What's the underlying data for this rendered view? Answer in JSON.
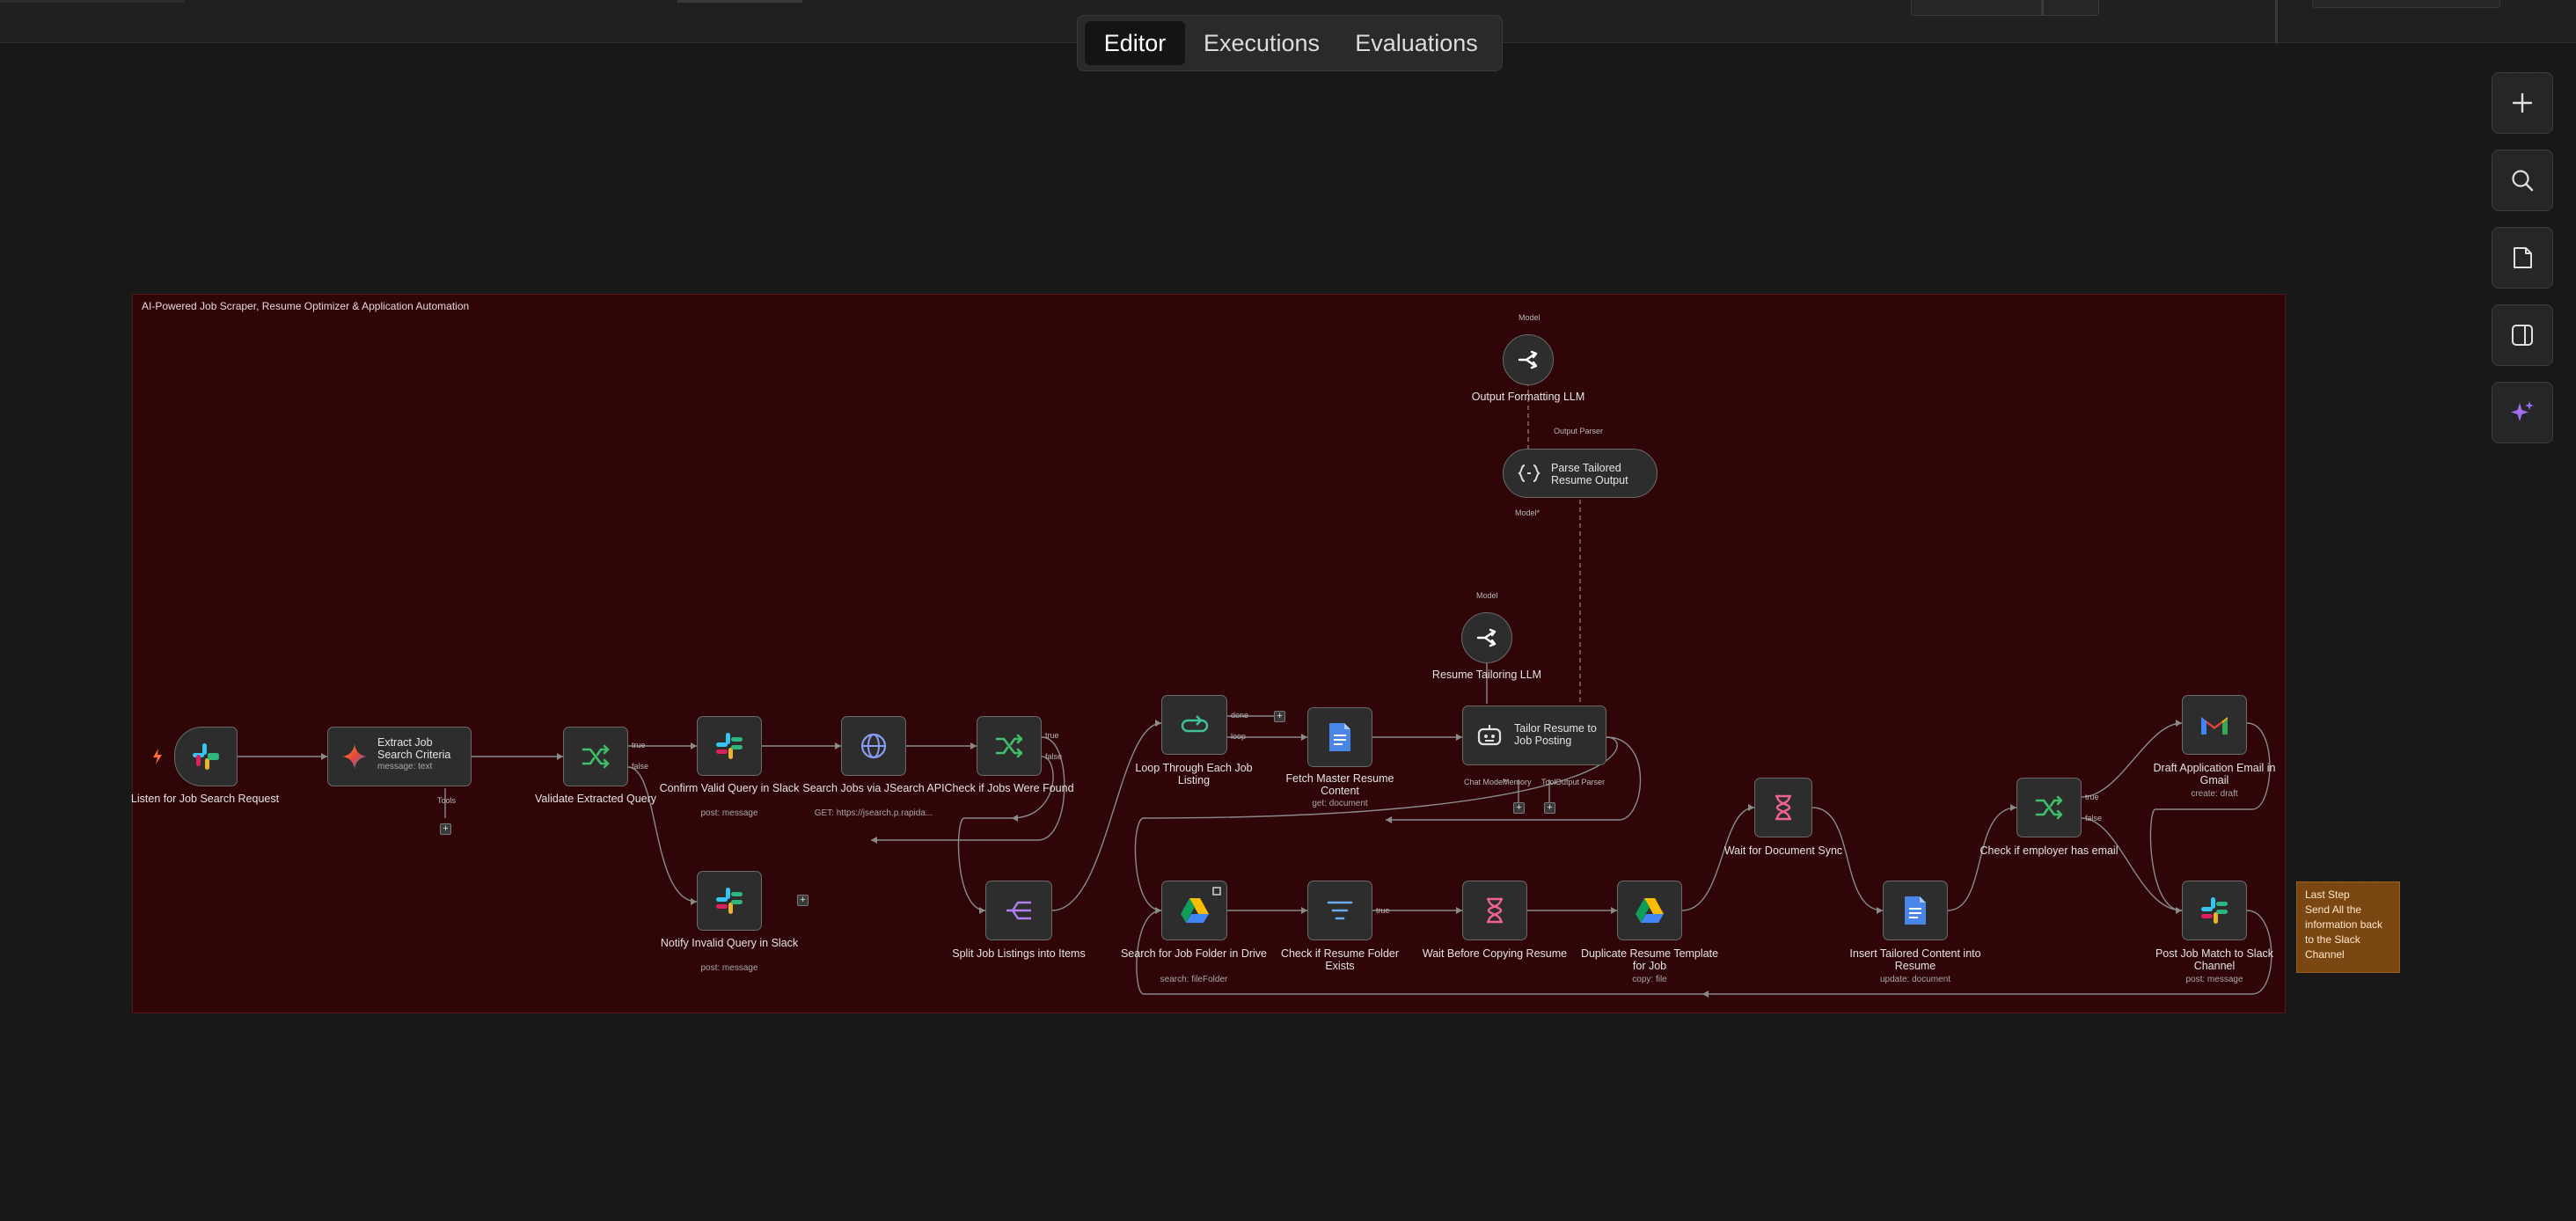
{
  "tabs": {
    "editor": "Editor",
    "executions": "Executions",
    "evaluations": "Evaluations"
  },
  "controls": [
    "plus-icon",
    "search-icon",
    "sticky-note-icon",
    "sidebar-icon",
    "sparkle-icon"
  ],
  "sticky_title": "AI-Powered Job Scraper, Resume Optimizer & Application Automation",
  "note": {
    "title": "Last Step",
    "body": [
      "Send All the",
      "information back",
      "to the Slack",
      "Channel"
    ]
  },
  "nodes": {
    "listen": {
      "label": "Listen for Job Search Request",
      "icon": "slack-icon"
    },
    "extract": {
      "label": "Extract Job Search Criteria",
      "sub": "message: text",
      "icon": "gemini-icon"
    },
    "validate": {
      "label": "Validate Extracted Query",
      "icon": "if-icon"
    },
    "confirm": {
      "label": "Confirm Valid Query in Slack",
      "sub": "post: message",
      "icon": "slack-icon"
    },
    "search": {
      "label": "Search Jobs via JSearch API",
      "sub": "GET: https://jsearch.p.rapida...",
      "icon": "globe-icon"
    },
    "check_found": {
      "label": "Check if Jobs Were Found",
      "icon": "if-icon"
    },
    "invalid": {
      "label": "Notify Invalid Query in Slack",
      "sub": "post: message",
      "icon": "slack-icon"
    },
    "split": {
      "label": "Split Job Listings into Items",
      "icon": "split-icon"
    },
    "loop": {
      "label": "Loop Through Each Job Listing",
      "icon": "loop-icon"
    },
    "fetch": {
      "label": "Fetch Master Resume Content",
      "sub": "get: document",
      "icon": "docs-icon"
    },
    "output_llm": {
      "label": "Output Formatting LLM",
      "icon": "openrouter-icon"
    },
    "parse": {
      "label": "Parse Tailored Resume Output",
      "icon": "braces-icon"
    },
    "tailor_llm": {
      "label": "Resume Tailoring LLM",
      "icon": "openrouter-icon"
    },
    "tailor": {
      "label": "Tailor Resume to Job Posting",
      "icon": "robot-icon"
    },
    "drive_search": {
      "label": "Search for Job Folder in Drive",
      "sub": "search: fileFolder",
      "icon": "drive-icon"
    },
    "check_folder": {
      "label": "Check if Resume Folder Exists",
      "icon": "filter-icon"
    },
    "wait_copy": {
      "label": "Wait Before Copying Resume",
      "icon": "hourglass-icon"
    },
    "duplicate": {
      "label": "Duplicate Resume Template for Job",
      "sub": "copy: file",
      "icon": "drive-icon"
    },
    "wait_sync": {
      "label": "Wait for Document Sync",
      "icon": "hourglass-icon"
    },
    "insert": {
      "label": "Insert Tailored Content into Resume",
      "sub": "update: document",
      "icon": "docs-icon"
    },
    "check_email": {
      "label": "Check if employer has email",
      "icon": "if-icon"
    },
    "draft": {
      "label": "Draft Application Email in Gmail",
      "sub": "create: draft",
      "icon": "gmail-icon"
    },
    "post": {
      "label": "Post Job Match to Slack Channel",
      "sub": "post: message",
      "icon": "slack-icon"
    }
  },
  "ports": {
    "true": "true",
    "false": "false",
    "done": "done",
    "loop": "loop",
    "tools": "Tools",
    "model": "Model",
    "model_req": "Model*",
    "output_parser": "Output Parser",
    "chat_model": "Chat Model*",
    "memory": "Memory",
    "tool": "Tool"
  },
  "colors": {
    "sticky": "#2f0507",
    "note": "#7a4713",
    "if": "#3fbf6a",
    "sparkle": "#a06cf0"
  }
}
